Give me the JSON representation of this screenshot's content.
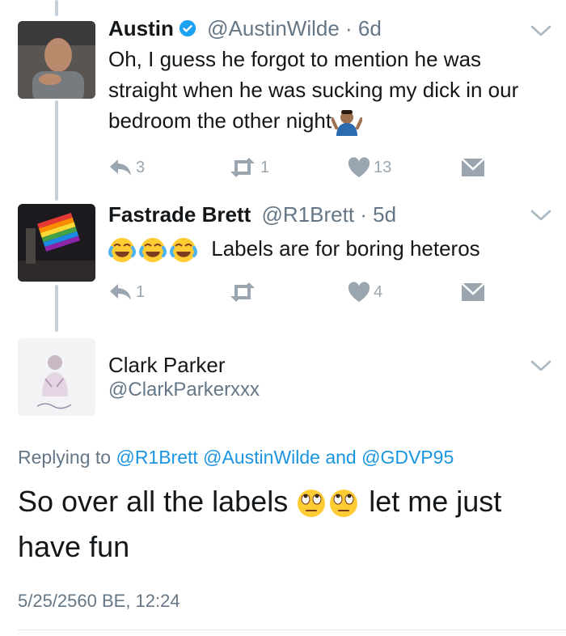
{
  "tweets": [
    {
      "name": "Austin",
      "verified": true,
      "handle": "@AustinWilde",
      "time": "· 6d",
      "text": "Oh, I guess he forgot to mention he was straight when he was sucking my dick in our bedroom the other night",
      "trailing_emoji": "shrug-emoji",
      "replies": "3",
      "retweets": "1",
      "likes": "13"
    },
    {
      "name": "Fastrade Brett",
      "handle": "@R1Brett",
      "time": "· 5d",
      "leading_emoji": [
        "tears-of-joy-emoji",
        "tears-of-joy-emoji",
        "tears-of-joy-emoji"
      ],
      "text": "Labels are for boring heteros",
      "replies": "1",
      "retweets": "",
      "likes": "4"
    }
  ],
  "focused": {
    "name": "Clark Parker",
    "handle": "@ClarkParkerxxx",
    "replying_prefix": "Replying to",
    "replying_to": "@R1Brett @AustinWilde and @GDVP95",
    "text_part1": "So over all the labels",
    "text_part2": "let me just have fun",
    "emoji": [
      "eye-roll-emoji",
      "eye-roll-emoji"
    ],
    "timestamp": "5/25/2560 BE, 12:24"
  },
  "colors": {
    "link": "#1b95e0",
    "muted": "#657786",
    "icon": "#9aa5b0",
    "thread": "#c6d0d8"
  }
}
